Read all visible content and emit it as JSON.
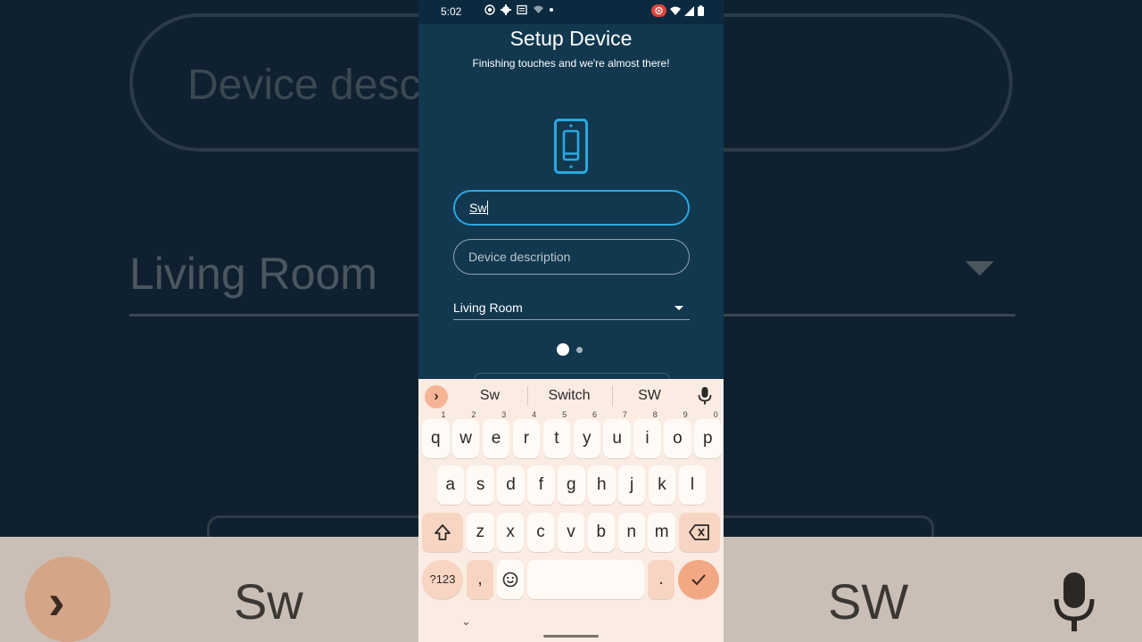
{
  "status_bar": {
    "time": "5:02"
  },
  "header": {
    "title": "Setup Device",
    "subtitle": "Finishing touches and we're almost there!"
  },
  "form": {
    "name_value": "Sw",
    "description_placeholder": "Device description",
    "room_selected": "Living Room"
  },
  "pager": {
    "current": 1,
    "total": 2
  },
  "keyboard": {
    "suggestions": [
      "Sw",
      "Switch",
      "SW"
    ],
    "row1": [
      "q",
      "w",
      "e",
      "r",
      "t",
      "y",
      "u",
      "i",
      "o",
      "p"
    ],
    "row1_hints": [
      "1",
      "2",
      "3",
      "4",
      "5",
      "6",
      "7",
      "8",
      "9",
      "0"
    ],
    "row2": [
      "a",
      "s",
      "d",
      "f",
      "g",
      "h",
      "j",
      "k",
      "l"
    ],
    "row3": [
      "z",
      "x",
      "c",
      "v",
      "b",
      "n",
      "m"
    ],
    "symbols_label": "?123",
    "comma": ",",
    "period": "."
  },
  "background": {
    "pill_text": "Device desc",
    "room_text": "Living Room",
    "sugg1": "Sw",
    "sugg2": "SW"
  },
  "colors": {
    "accent": "#2aa8e0",
    "app_bg": "#12384f",
    "keyboard_bg": "#faece3",
    "key_accent": "#f3a884"
  }
}
